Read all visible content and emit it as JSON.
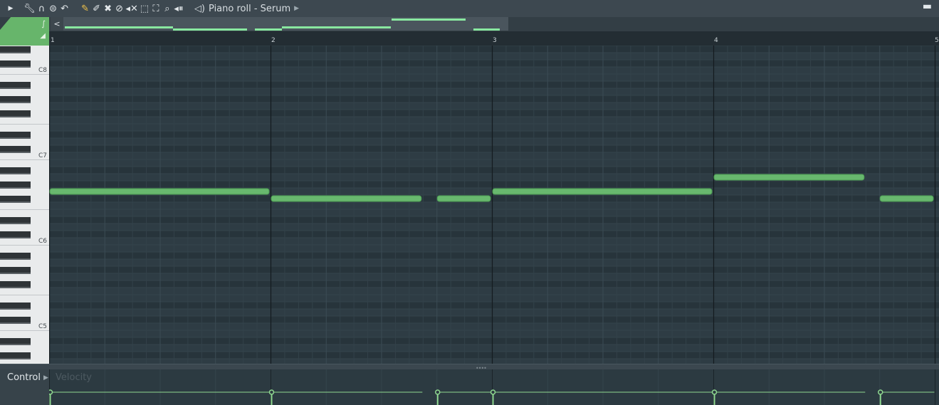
{
  "window": {
    "title": "Piano roll - Serum"
  },
  "toolbar": {
    "icons": [
      "menu-arrow-icon",
      "wrench-icon",
      "magnet-icon",
      "snap-icon",
      "undo-icon",
      "pencil-icon",
      "paint-icon",
      "delete-icon",
      "mute-icon",
      "slice-icon",
      "select-icon",
      "zoom-icon",
      "playback-icon",
      "speaker-icon"
    ]
  },
  "ruler": {
    "bars": [
      "1",
      "2",
      "3",
      "4",
      "5"
    ]
  },
  "keyboard": {
    "labels": [
      "C8",
      "C7",
      "C6",
      "C5"
    ]
  },
  "notes": [
    {
      "pitch": "G6",
      "start_bar": 1.0,
      "length_beats": 4.0
    },
    {
      "pitch": "F#6",
      "start_bar": 2.0,
      "length_beats": 2.75
    },
    {
      "pitch": "F#6",
      "start_bar": 2.75,
      "length_beats": 1.0
    },
    {
      "pitch": "G6",
      "start_bar": 3.0,
      "length_beats": 4.0
    },
    {
      "pitch": "A6",
      "start_bar": 4.0,
      "length_beats": 2.75
    },
    {
      "pitch": "F#6",
      "start_bar": 4.75,
      "length_beats": 1.0
    }
  ],
  "control": {
    "label": "Control",
    "parameter": "Velocity"
  },
  "colors": {
    "note": "#68b86e",
    "accent": "#67b56b",
    "grid_bg": "#2b3840"
  }
}
